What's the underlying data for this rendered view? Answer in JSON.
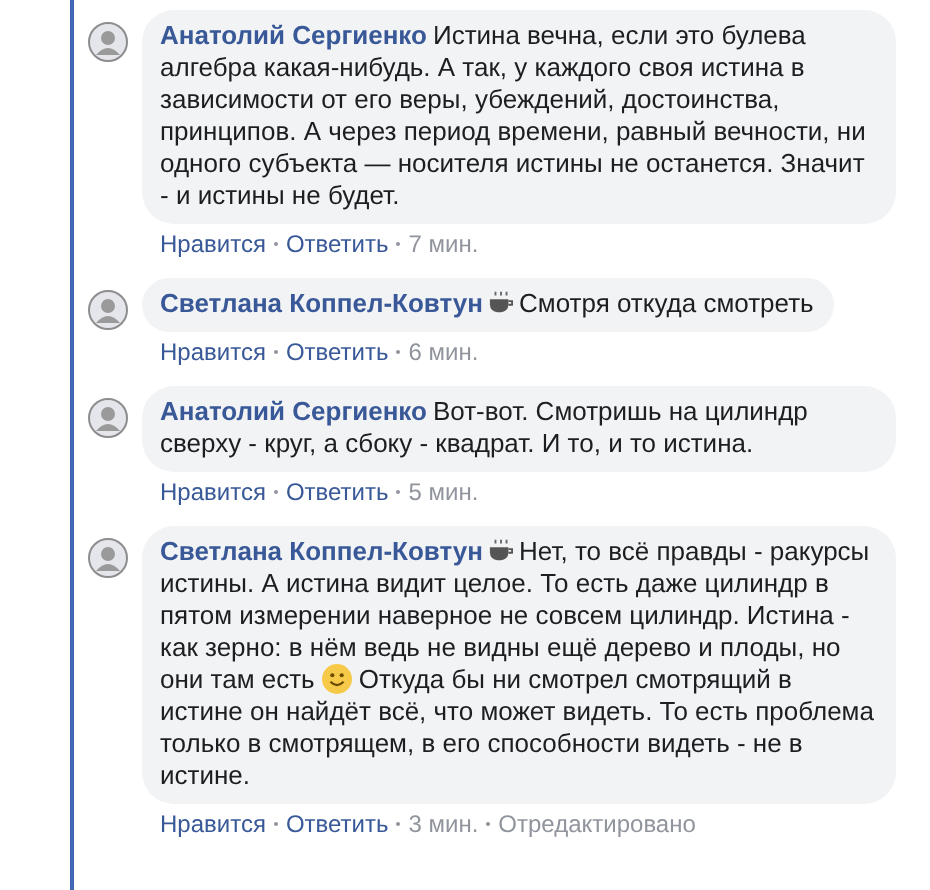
{
  "comments": [
    {
      "author": "Анатолий Сергиенко",
      "parts": [
        {
          "kind": "text",
          "text": "Истина вечна, если это булева алгебра какая-нибудь. А так, у каждого своя истина в зависимости от его веры, убеждений, достоинства, принципов. А через период времени, равный вечности, ни одного субъекта — носителя истины не останется. Значит - и истины не будет."
        }
      ],
      "actions": [
        "Нравится",
        "Ответить"
      ],
      "time": "7 мин."
    },
    {
      "author": "Светлана Коппел-Ковтун",
      "parts": [
        {
          "kind": "coffee"
        },
        {
          "kind": "text",
          "text": "Смотря откуда смотреть"
        }
      ],
      "actions": [
        "Нравится",
        "Ответить"
      ],
      "time": "6 мин."
    },
    {
      "author": "Анатолий Сергиенко",
      "parts": [
        {
          "kind": "text",
          "text": "Вот-вот. Смотришь на цилиндр сверху - круг, а сбоку - квадрат. И то, и то истина."
        }
      ],
      "actions": [
        "Нравится",
        "Ответить"
      ],
      "time": "5 мин."
    },
    {
      "author": "Светлана Коппел-Ковтун",
      "parts": [
        {
          "kind": "coffee"
        },
        {
          "kind": "text",
          "text": "Нет, то всё правды - ракурсы истины. А истина видит целое. То есть даже цилиндр в пятом измерении наверное не совсем цилиндр. Истина - как зерно: в нём ведь не видны ещё дерево и плоды, но они там есть"
        },
        {
          "kind": "smile"
        },
        {
          "kind": "text",
          "text": "Откуда бы ни смотрел смотрящий в истине он найдёт всё, что может видеть. То есть проблема только в смотрящем, в его способности видеть - не в истине."
        }
      ],
      "actions": [
        "Нравится",
        "Ответить"
      ],
      "time": "3 мин.",
      "edited": "Отредактировано"
    }
  ]
}
